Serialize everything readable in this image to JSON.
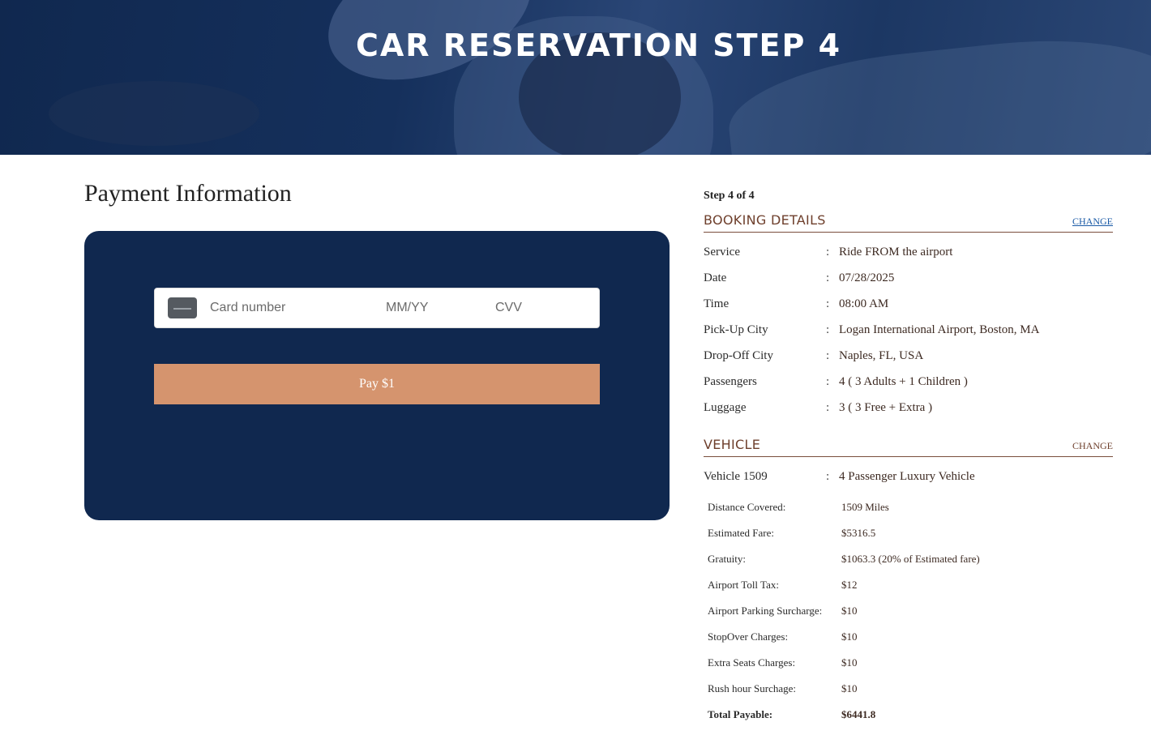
{
  "hero": {
    "title": "CAR RESERVATION STEP 4"
  },
  "payment": {
    "title": "Payment Information",
    "card_number_placeholder": "Card number",
    "expiry_placeholder": "MM/YY",
    "cvv_placeholder": "CVV",
    "pay_label": "Pay $1",
    "card_icon": "credit-card-icon"
  },
  "summary": {
    "step": "Step 4 of 4",
    "booking": {
      "title": "BOOKING DETAILS",
      "change_label": "CHANGE",
      "rows": [
        {
          "label": "Service",
          "value": "Ride FROM the airport"
        },
        {
          "label": "Date",
          "value": "07/28/2025"
        },
        {
          "label": "Time",
          "value": "08:00 AM"
        },
        {
          "label": "Pick-Up City",
          "value": "Logan International Airport, Boston, MA"
        },
        {
          "label": "Drop-Off City",
          "value": "Naples, FL, USA"
        },
        {
          "label": "Passengers",
          "value": "4 ( 3 Adults + 1 Children )"
        },
        {
          "label": "Luggage",
          "value": "3 ( 3 Free + Extra )"
        }
      ]
    },
    "vehicle": {
      "title": "VEHICLE",
      "change_label": "CHANGE",
      "name_label": "Vehicle 1509",
      "name_value": "4 Passenger Luxury Vehicle",
      "fares": [
        {
          "label": "Distance Covered:",
          "value": "1509 Miles"
        },
        {
          "label": "Estimated Fare:",
          "value": "$5316.5"
        },
        {
          "label": "Gratuity:",
          "value": "$1063.3 (20% of Estimated fare)"
        },
        {
          "label": "Airport Toll Tax:",
          "value": "$12"
        },
        {
          "label": "Airport Parking Surcharge:",
          "value": "$10"
        },
        {
          "label": "StopOver Charges:",
          "value": "$10"
        },
        {
          "label": "Extra Seats Charges:",
          "value": "$10"
        },
        {
          "label": "Rush hour Surchage:",
          "value": "$10"
        },
        {
          "label": "Total Payable:",
          "value": "$6441.8"
        }
      ]
    },
    "separator": ":"
  },
  "colors": {
    "hero_bg": "#10284f",
    "card_bg": "#10284f",
    "pay_button": "#d5946e",
    "accent_brown": "#6e3f2c",
    "link_blue": "#1a5aa6"
  }
}
